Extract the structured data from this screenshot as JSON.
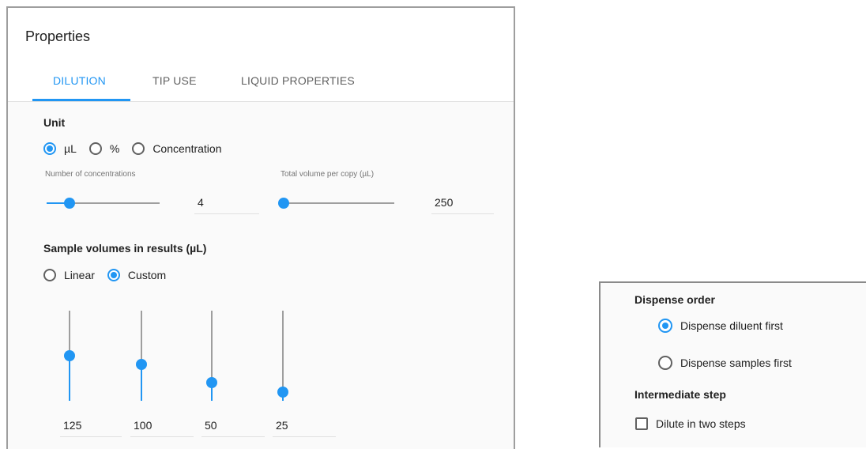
{
  "panel": {
    "title": "Properties",
    "tabs": [
      {
        "label": "DILUTION",
        "active": true
      },
      {
        "label": "TIP USE",
        "active": false
      },
      {
        "label": "LIQUID PROPERTIES",
        "active": false
      }
    ]
  },
  "unit": {
    "label": "Unit",
    "options": [
      {
        "label": "µL",
        "selected": true
      },
      {
        "label": "%",
        "selected": false
      },
      {
        "label": "Concentration",
        "selected": false
      }
    ]
  },
  "concentrations": {
    "label": "Number of concentrations",
    "value": "4",
    "slider_fraction": 0.2
  },
  "total_volume": {
    "label": "Total volume per copy (µL)",
    "value": "250",
    "slider_fraction": 0.0
  },
  "sample_volumes": {
    "label": "Sample volumes in results (µL)",
    "options": [
      {
        "label": "Linear",
        "selected": false
      },
      {
        "label": "Custom",
        "selected": true
      }
    ],
    "sliders": [
      {
        "value": "125",
        "fraction": 0.5
      },
      {
        "value": "100",
        "fraction": 0.4
      },
      {
        "value": "50",
        "fraction": 0.2
      },
      {
        "value": "25",
        "fraction": 0.1
      }
    ]
  },
  "dispense": {
    "label": "Dispense order",
    "options": [
      {
        "label": "Dispense diluent first",
        "selected": true
      },
      {
        "label": "Dispense samples first",
        "selected": false
      }
    ]
  },
  "intermediate": {
    "label": "Intermediate step",
    "checkbox_label": "Dilute in two steps",
    "checked": false
  },
  "colors": {
    "accent": "#2196f3",
    "text": "#212121",
    "muted": "#757575"
  }
}
